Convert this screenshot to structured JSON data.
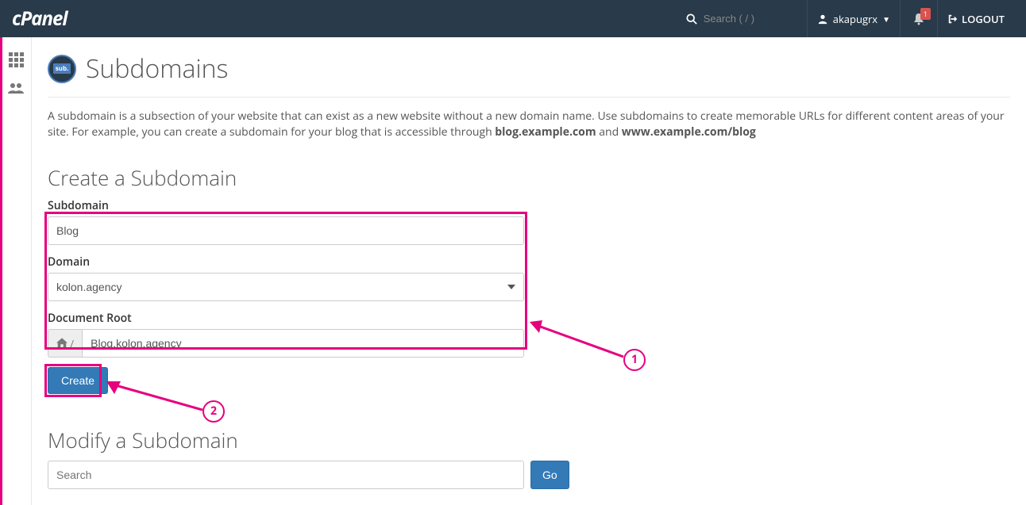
{
  "header": {
    "logo_text": "cPanel",
    "search_placeholder": "Search ( / )",
    "username": "akapugrx",
    "notification_count": "1",
    "logout_label": "LOGOUT"
  },
  "page": {
    "icon_label": "sub.",
    "title": "Subdomains",
    "description_prefix": "A subdomain is a subsection of your website that can exist as a new website without a new domain name. Use subdomains to create memorable URLs for different content areas of your site. For example, you can create a subdomain for your blog that is accessible through ",
    "description_bold1": "blog.example.com",
    "description_mid": " and ",
    "description_bold2": "www.example.com/blog"
  },
  "create": {
    "section_title": "Create a Subdomain",
    "subdomain_label": "Subdomain",
    "subdomain_value": "Blog",
    "domain_label": "Domain",
    "domain_value": "kolon.agency",
    "docroot_label": "Document Root",
    "docroot_addon": "/",
    "docroot_value": "Blog.kolon.agency",
    "create_button": "Create"
  },
  "modify": {
    "section_title": "Modify a Subdomain",
    "search_placeholder": "Search",
    "go_button": "Go"
  },
  "annotations": {
    "callout1": "1",
    "callout2": "2"
  }
}
